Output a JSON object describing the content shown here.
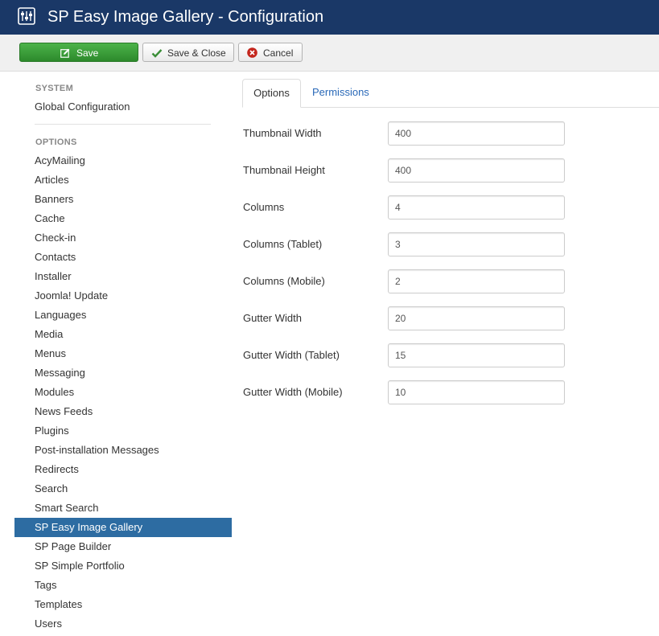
{
  "header": {
    "title": "SP Easy Image Gallery - Configuration",
    "icon": "sliders-icon"
  },
  "toolbar": {
    "save_label": "Save",
    "save_close_label": "Save & Close",
    "cancel_label": "Cancel"
  },
  "sidebar": {
    "system_header": "SYSTEM",
    "system_items": [
      "Global Configuration"
    ],
    "options_header": "OPTIONS",
    "items": [
      "AcyMailing",
      "Articles",
      "Banners",
      "Cache",
      "Check-in",
      "Contacts",
      "Installer",
      "Joomla! Update",
      "Languages",
      "Media",
      "Menus",
      "Messaging",
      "Modules",
      "News Feeds",
      "Plugins",
      "Post-installation Messages",
      "Redirects",
      "Search",
      "Smart Search",
      "SP Easy Image Gallery",
      "SP Page Builder",
      "SP Simple Portfolio",
      "Tags",
      "Templates",
      "Users"
    ],
    "active_item": "SP Easy Image Gallery"
  },
  "tabs": [
    {
      "label": "Options",
      "active": true
    },
    {
      "label": "Permissions",
      "active": false
    }
  ],
  "form": {
    "fields": [
      {
        "label": "Thumbnail Width",
        "value": "400"
      },
      {
        "label": "Thumbnail Height",
        "value": "400"
      },
      {
        "label": "Columns",
        "value": "4"
      },
      {
        "label": "Columns (Tablet)",
        "value": "3"
      },
      {
        "label": "Columns (Mobile)",
        "value": "2"
      },
      {
        "label": "Gutter Width",
        "value": "20"
      },
      {
        "label": "Gutter Width (Tablet)",
        "value": "15"
      },
      {
        "label": "Gutter Width (Mobile)",
        "value": "10"
      }
    ]
  },
  "colors": {
    "header_bg": "#1a3867",
    "save_green": "#3a9e38",
    "active_blue": "#2d6ca2",
    "link_blue": "#2a69b8"
  }
}
